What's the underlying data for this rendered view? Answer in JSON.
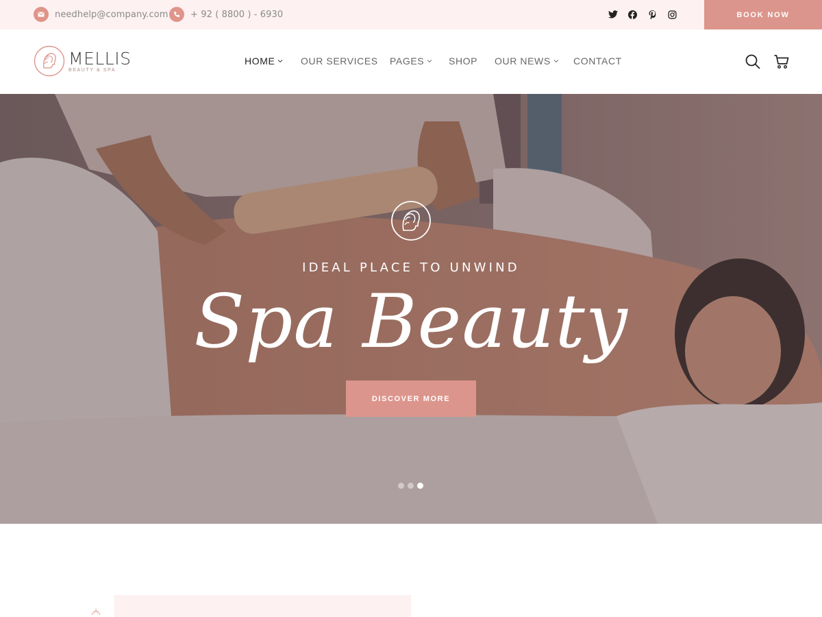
{
  "topbar": {
    "email": "needhelp@company.com",
    "phone": "+ 92 ( 8800 ) - 6930",
    "social_icons": [
      "twitter-icon",
      "facebook-icon",
      "pinterest-icon",
      "instagram-icon"
    ],
    "book_label": "BOOK NOW"
  },
  "header": {
    "logo_name": "MELLIS",
    "logo_tagline": "BEAUTY & SPA",
    "nav": [
      {
        "label": "HOME",
        "dropdown": true,
        "active": true
      },
      {
        "label": "OUR SERVICES",
        "dropdown": false
      },
      {
        "label": "PAGES",
        "dropdown": true
      },
      {
        "label": "SHOP",
        "dropdown": false
      },
      {
        "label": "OUR NEWS",
        "dropdown": true
      },
      {
        "label": "CONTACT",
        "dropdown": false
      }
    ],
    "icons": [
      "search-icon",
      "cart-icon"
    ]
  },
  "hero": {
    "kicker": "IDEAL PLACE TO UNWIND",
    "title": "Spa Beauty",
    "button_label": "DISCOVER MORE",
    "slides_total": 3,
    "active_slide": 3
  },
  "colors": {
    "accent": "#dc958c",
    "topbar_bg": "#fdf1f1",
    "text_dark": "#222222"
  }
}
